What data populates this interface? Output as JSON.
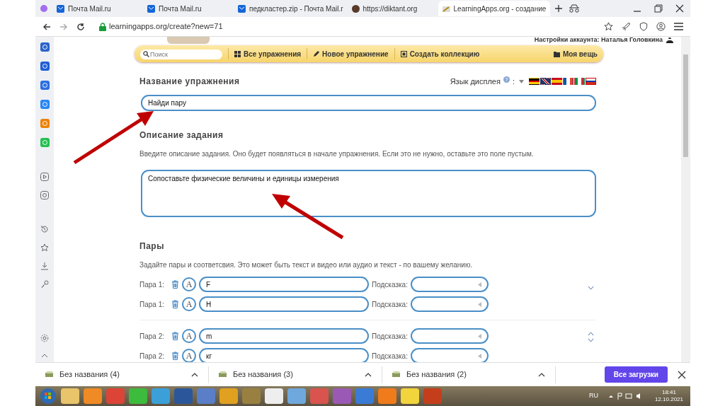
{
  "browser": {
    "tabs": [
      {
        "title": "Почта Mail.ru",
        "kind": "mail",
        "selected": false
      },
      {
        "title": "Почта Mail.ru",
        "kind": "mail",
        "selected": false
      },
      {
        "title": "педкластер.zip - Почта Mail.r",
        "kind": "mail",
        "selected": false
      },
      {
        "title": "https://diktant.org",
        "kind": "site",
        "selected": false
      },
      {
        "title": "LearningApps.org - создание",
        "kind": "apps",
        "selected": true
      }
    ],
    "url": "learningapps.org/create?new=71"
  },
  "account": {
    "text": "Настройки аккаунта: Наталья Головкина"
  },
  "toolbar": {
    "search_placeholder": "Поиск",
    "items": [
      {
        "label": "Все упражнения",
        "kind": "grid"
      },
      {
        "label": "Новое упражнение",
        "kind": "pencil"
      },
      {
        "label": "Создать коллекцию",
        "kind": "collection"
      },
      {
        "label": "Моя вещь",
        "kind": "folder"
      }
    ]
  },
  "title_section": {
    "heading": "Название упражнения",
    "language_label": "Язык дисплея",
    "help": "?",
    "colon": ":",
    "languages": [
      {
        "kind": "de",
        "selected": false
      },
      {
        "kind": "gb",
        "selected": false
      },
      {
        "kind": "es",
        "selected": false
      },
      {
        "kind": "fr",
        "selected": false
      },
      {
        "kind": "it",
        "selected": false
      },
      {
        "kind": "ru",
        "selected": true
      }
    ],
    "value": "Найди пару"
  },
  "task": {
    "heading": "Описание задания",
    "hint": "Введите описание задания. Оно будет появляться в начале упражнения. Если это не нужно, оставьте это поле пустым.",
    "value": "Сопоставьте физические величины и единицы измерения"
  },
  "pairs": {
    "heading": "Пары",
    "hint": "Задайте пары и соответсвия. Это может быть текст и видео или аудио и текст - по вашему желанию.",
    "groups": [
      {
        "move_up": false,
        "move_down": true,
        "items": [
          {
            "label": "Пара 1:",
            "font_button": "A",
            "value": "F",
            "hint_label": "Подсказка:"
          },
          {
            "label": "Пара 1:",
            "font_button": "A",
            "value": "Н",
            "hint_label": "Подсказка:"
          }
        ]
      },
      {
        "move_up": true,
        "move_down": true,
        "items": [
          {
            "label": "Пара 2:",
            "font_button": "A",
            "value": "m",
            "hint_label": "Подсказка:"
          },
          {
            "label": "Пара 2:",
            "font_button": "A",
            "value": "кг",
            "hint_label": "Подсказка:"
          }
        ]
      }
    ]
  },
  "downloads": {
    "items": [
      "Без названия (4)",
      "Без названия (3)",
      "Без названия (2)"
    ],
    "all_button": "Все загрузки"
  },
  "taskbar": {
    "language": "RU",
    "time": "18:41",
    "date": "12.10.2021"
  }
}
